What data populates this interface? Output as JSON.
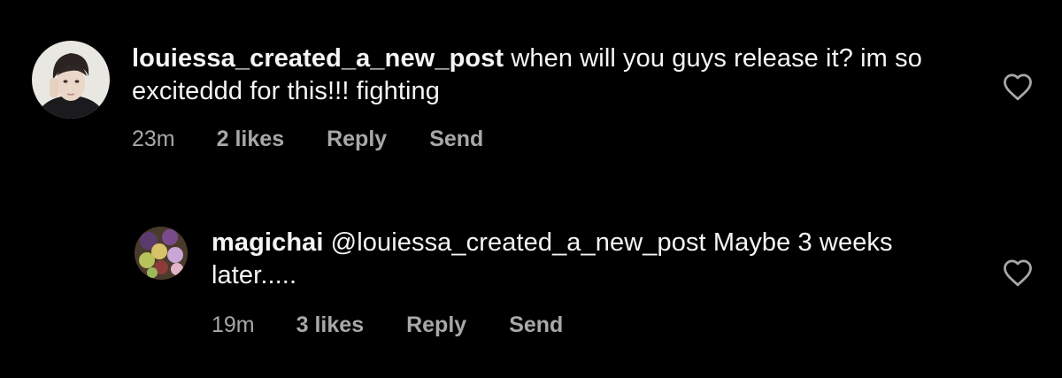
{
  "colors": {
    "background": "#000000",
    "primary_text": "#f5f5f5",
    "secondary_text": "#a8a8a8"
  },
  "comments": [
    {
      "username": "louiessa_created_a_new_post",
      "text": " when will you guys release it? im so exciteddd for this!!! fighting",
      "time": "23m",
      "likes": "2 likes",
      "reply_label": "Reply",
      "send_label": "Send",
      "like_icon": "heart-outline-icon"
    },
    {
      "username": "magichai",
      "text": " @louiessa_created_a_new_post Maybe 3 weeks later.....",
      "time": "19m",
      "likes": "3 likes",
      "reply_label": "Reply",
      "send_label": "Send",
      "like_icon": "heart-outline-icon"
    }
  ]
}
